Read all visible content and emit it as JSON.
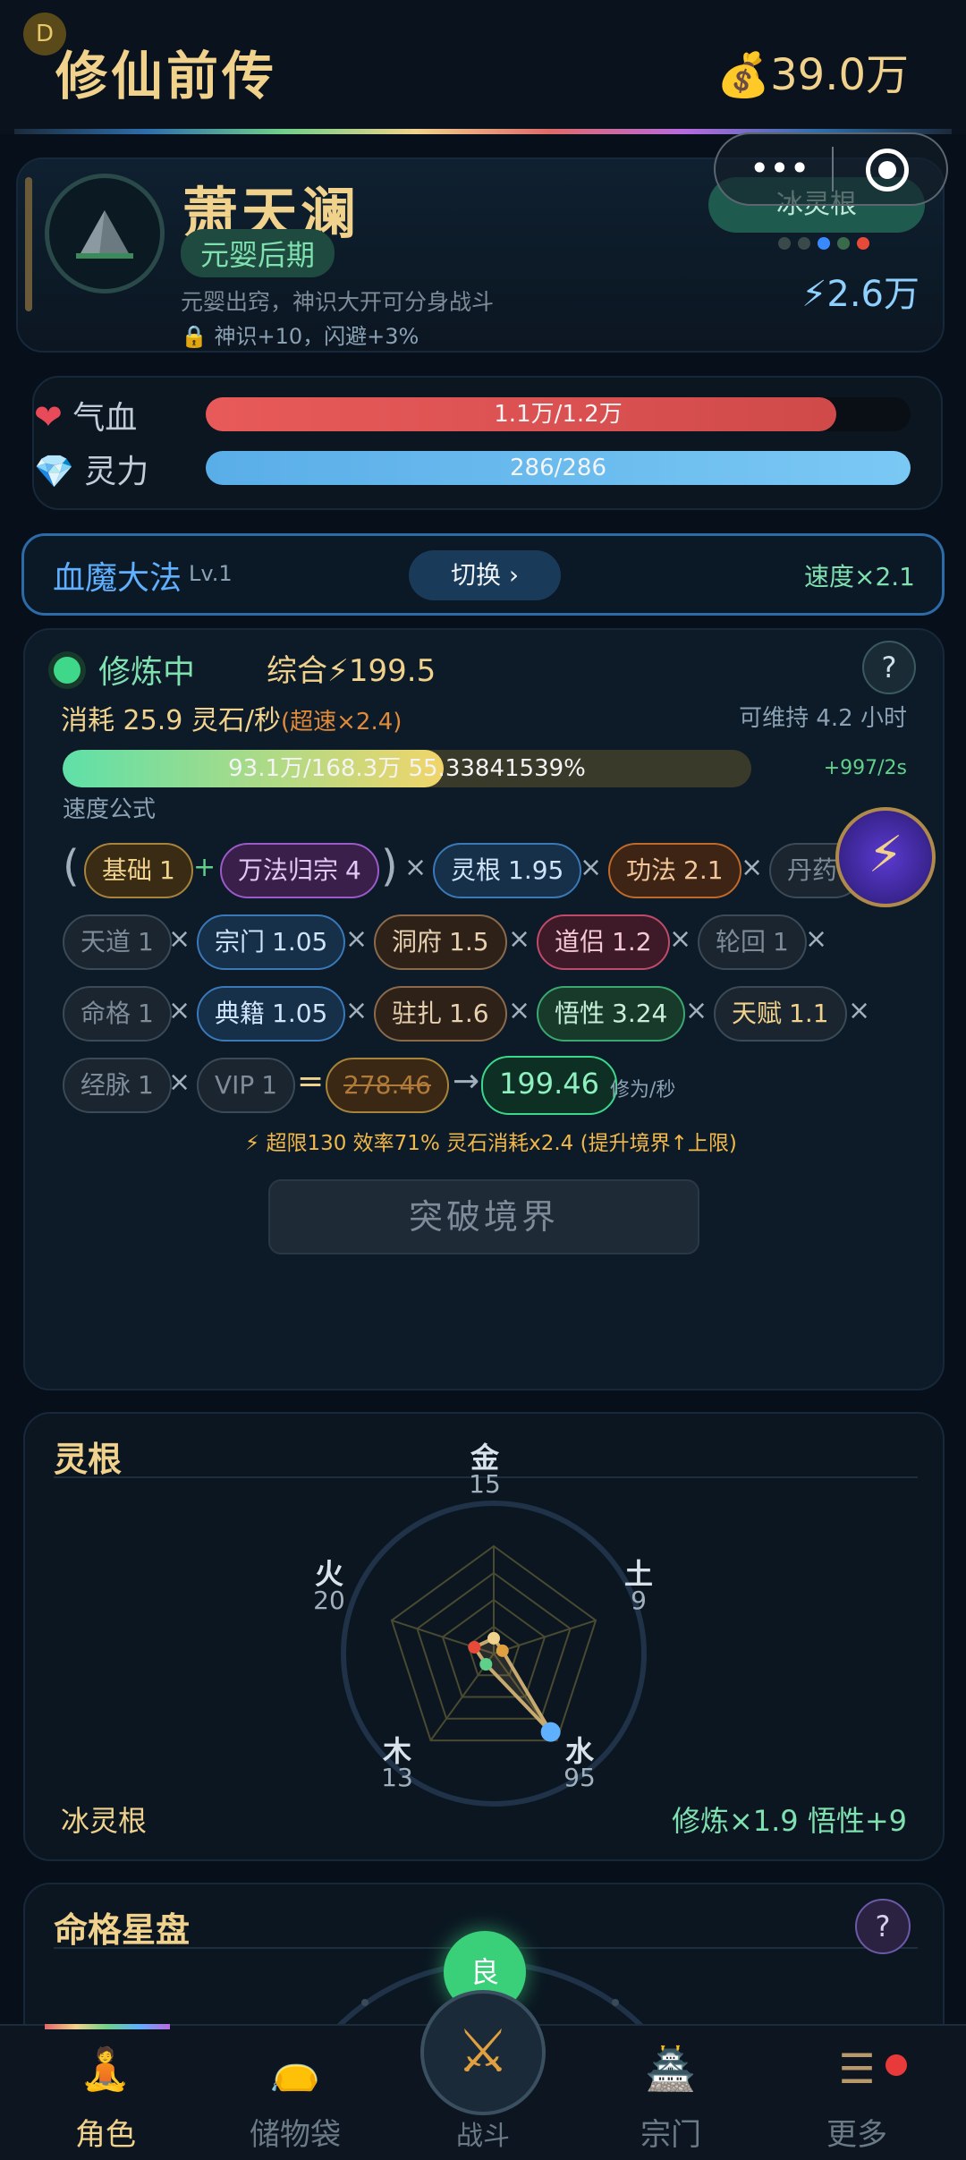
{
  "header": {
    "badge": "D",
    "title": "修仙前传",
    "coins": "💰39.0万"
  },
  "character": {
    "name": "萧天澜",
    "realm": "元婴后期",
    "description": "元婴出窍，神识大开可分身战斗",
    "bonus": "🔒 神识+10，闪避+3%",
    "root_tag": "冰灵根",
    "power": "⚡2.6万",
    "root_dot_colors": [
      "#3a4a4a",
      "#3a4a4a",
      "#3a8aff",
      "#3a6a4a",
      "#e84a3a"
    ]
  },
  "stats": {
    "hp_label": "气血",
    "hp_text": "1.1万/1.2万",
    "hp_fraction": 0.895,
    "mp_label": "灵力",
    "mp_text": "286/286",
    "mp_fraction": 1.0
  },
  "technique": {
    "name": "血魔大法",
    "level": "Lv.1",
    "switch_label": "切换 ›",
    "speed": "速度×2.1"
  },
  "cultivation": {
    "status": "修炼中",
    "total": "综合⚡199.5",
    "help": "?",
    "cost_main": "消耗 25.9 灵石/秒",
    "cost_over": "(超速×2.4)",
    "sustain": "可维持 4.2 小时",
    "progress_text": "93.1万/168.3万  55.33841539%",
    "progress_fraction": 0.553,
    "gain": "+997/2s",
    "formula_label": "速度公式",
    "chips": {
      "base": {
        "name": "基础",
        "val": "1"
      },
      "wanfa": {
        "name": "万法归宗",
        "val": "4"
      },
      "linggen": {
        "name": "灵根",
        "val": "1.95"
      },
      "gongfa": {
        "name": "功法",
        "val": "2.1"
      },
      "danyao": {
        "name": "丹药",
        "val": ""
      },
      "tiandao": {
        "name": "天道",
        "val": "1"
      },
      "zongmen": {
        "name": "宗门",
        "val": "1.05"
      },
      "dongfu": {
        "name": "洞府",
        "val": "1.5"
      },
      "daolv": {
        "name": "道侣",
        "val": "1.2"
      },
      "lunhui": {
        "name": "轮回",
        "val": "1"
      },
      "mingge": {
        "name": "命格",
        "val": "1"
      },
      "dianji": {
        "name": "典籍",
        "val": "1.05"
      },
      "zhuzha": {
        "name": "驻扎",
        "val": "1.6"
      },
      "wuxing": {
        "name": "悟性",
        "val": "3.24"
      },
      "tianfu": {
        "name": "天赋",
        "val": "1.1"
      },
      "jingmai": {
        "name": "经脉",
        "val": "1"
      },
      "vip": {
        "name": "VIP",
        "val": "1"
      },
      "raw": "278.46",
      "result": "199.46"
    },
    "unit": "修为/秒",
    "warning": "⚡ 超限130 效率71% 灵石消耗x2.4 (提升境界↑上限)",
    "breakthrough": "突破境界"
  },
  "spirit_root": {
    "title": "灵根",
    "elements": [
      {
        "name": "金",
        "value": 15,
        "color": "#f1d28c"
      },
      {
        "name": "土",
        "value": 9,
        "color": "#e0a040"
      },
      {
        "name": "水",
        "value": 95,
        "color": "#5fb0ff"
      },
      {
        "name": "木",
        "value": 13,
        "color": "#5fd08a"
      },
      {
        "name": "火",
        "value": 20,
        "color": "#e84a3a"
      }
    ],
    "root_name": "冰灵根",
    "effect": "修炼×1.9  悟性+9"
  },
  "fate": {
    "title": "命格星盘",
    "help": "?",
    "badge": "良"
  },
  "nav": {
    "role": "角色",
    "bag": "储物袋",
    "battle": "战斗",
    "sect": "宗门",
    "more": "更多"
  }
}
